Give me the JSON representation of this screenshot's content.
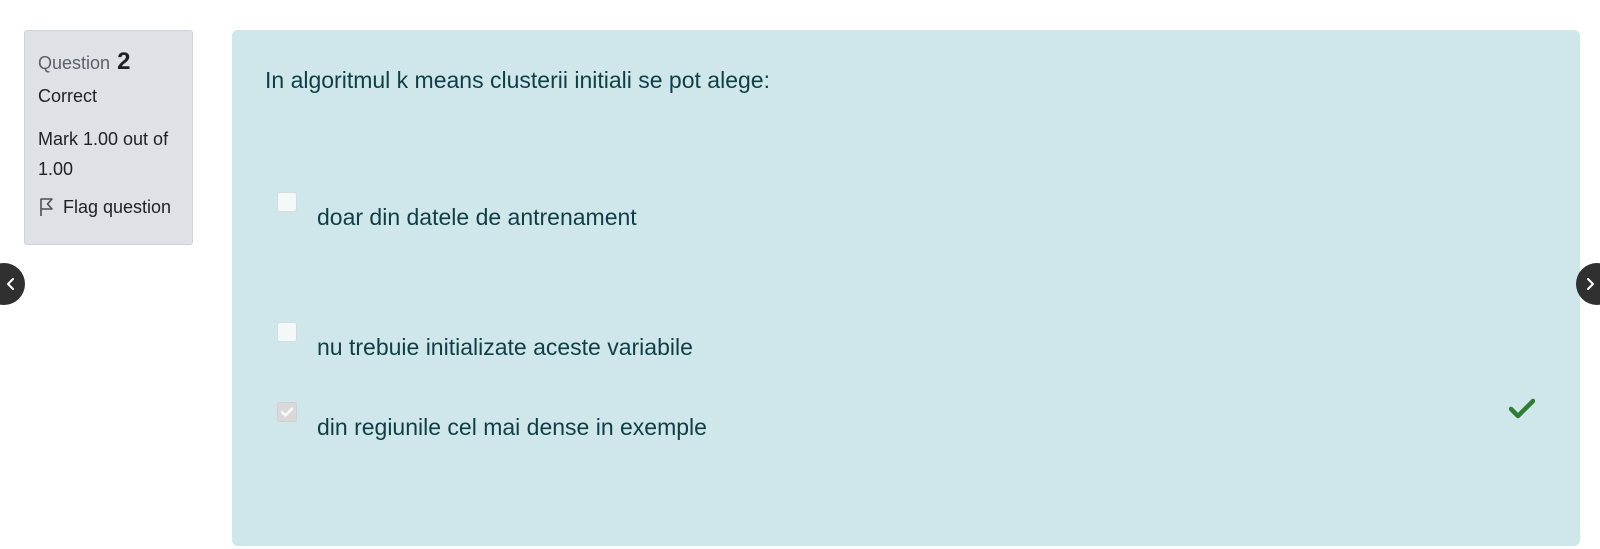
{
  "info": {
    "question_prefix": "Question",
    "question_number": "2",
    "state": "Correct",
    "grade": "Mark 1.00 out of 1.00",
    "flag_label": "Flag question"
  },
  "question": {
    "text": "In algoritmul k means clusterii initiali se pot alege:",
    "answers": [
      {
        "label": "doar din datele de antrenament",
        "checked": false
      },
      {
        "label": "nu trebuie initializate aceste variabile",
        "checked": false
      },
      {
        "label": "din regiunile cel mai dense in exemple",
        "checked": true
      }
    ]
  },
  "colors": {
    "content_bg": "#cfe6ea",
    "info_bg": "#dee2e6",
    "correct_tick": "#2e7d32",
    "nav_bg": "#303030"
  },
  "icons": {
    "flag": "flag-outline-icon",
    "tick": "check-icon",
    "prev": "chevron-left-icon",
    "next": "chevron-right-icon"
  }
}
